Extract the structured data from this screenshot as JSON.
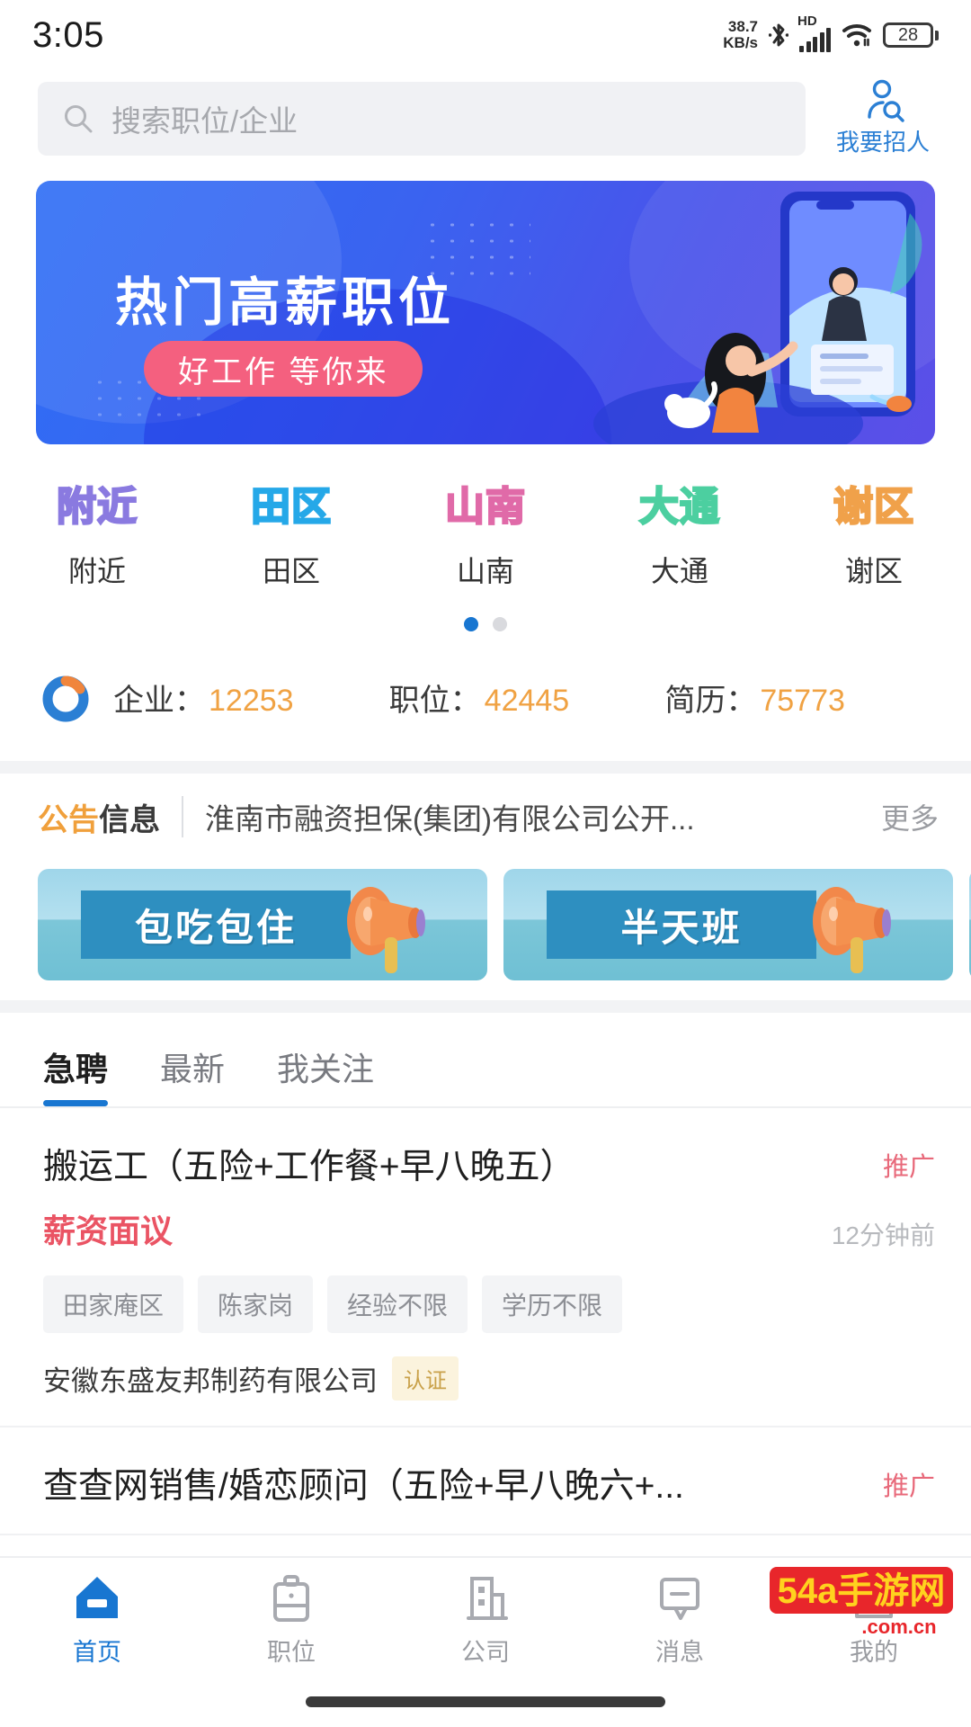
{
  "status_bar": {
    "time": "3:05",
    "net_speed_value": "38.7",
    "net_speed_unit": "KB/s",
    "hd_label": "HD",
    "battery_level": "28",
    "icons": [
      "bluetooth-icon",
      "signal-icon",
      "wifi-icon",
      "battery-icon"
    ]
  },
  "search": {
    "placeholder": "搜索职位/企业",
    "icon": "search-icon"
  },
  "recruit": {
    "label": "我要招人",
    "icon": "person-search-icon",
    "color": "#2b7fd4"
  },
  "banner": {
    "title": "热门高薪职位",
    "pill_text": "好工作 等你来",
    "pill_color": "#f4607f",
    "bg_from": "#2f6ef5",
    "bg_to": "#5b4fe8"
  },
  "categories": {
    "items": [
      {
        "label": "附近",
        "icon_text": "附近",
        "color": "#8a7ae0"
      },
      {
        "label": "田区",
        "icon_text": "田区",
        "color": "#25a8e8"
      },
      {
        "label": "山南",
        "icon_text": "山南",
        "color": "#e06aa8"
      },
      {
        "label": "大通",
        "icon_text": "大通",
        "color": "#4ccfa0"
      },
      {
        "label": "谢区",
        "icon_text": "谢区",
        "color": "#f0a14a"
      }
    ],
    "pager": {
      "total": 2,
      "active": 1
    }
  },
  "stats": {
    "logo_icon": "donut-chart-icon",
    "items": [
      {
        "label": "企业：",
        "value": "12253"
      },
      {
        "label": "职位：",
        "value": "42445"
      },
      {
        "label": "简历：",
        "value": "75773"
      }
    ],
    "value_color": "#f0a243"
  },
  "announcement": {
    "tag_orange": "公告",
    "tag_dark": "信息",
    "text": "淮南市融资担保(集团)有限公司公开...",
    "more": "更多"
  },
  "promos": {
    "items": [
      {
        "text": "包吃包住",
        "icon": "megaphone-icon"
      },
      {
        "text": "半天班",
        "icon": "megaphone-icon"
      },
      {
        "text": "",
        "icon": "megaphone-icon"
      }
    ]
  },
  "tabs": {
    "items": [
      {
        "label": "急聘",
        "active": true
      },
      {
        "label": "最新",
        "active": false
      },
      {
        "label": "我关注",
        "active": false
      }
    ],
    "active_color": "#1876d1"
  },
  "jobs": [
    {
      "title": "搬运工（五险+工作餐+早八晚五）",
      "promo_badge": "推广",
      "salary": "薪资面议",
      "time": "12分钟前",
      "tags": [
        "田家庵区",
        "陈家岗",
        "经验不限",
        "学历不限"
      ],
      "company": "安徽东盛友邦制药有限公司",
      "verified_badge": "认证"
    },
    {
      "title": "查查网销售/婚恋顾问（五险+早八晚六+...",
      "promo_badge": "推广",
      "salary": "",
      "time": "",
      "tags": [],
      "company": "",
      "verified_badge": ""
    }
  ],
  "bottom_nav": {
    "items": [
      {
        "label": "首页",
        "icon": "home-icon",
        "active": true
      },
      {
        "label": "职位",
        "icon": "briefcase-icon",
        "active": false
      },
      {
        "label": "公司",
        "icon": "building-icon",
        "active": false
      },
      {
        "label": "消息",
        "icon": "message-icon",
        "active": false
      },
      {
        "label": "我的",
        "icon": "profile-card-icon",
        "active": false
      }
    ],
    "active_color": "#1876d1"
  },
  "watermark": {
    "text": "54a手游网",
    "sub": ".com.cn"
  }
}
